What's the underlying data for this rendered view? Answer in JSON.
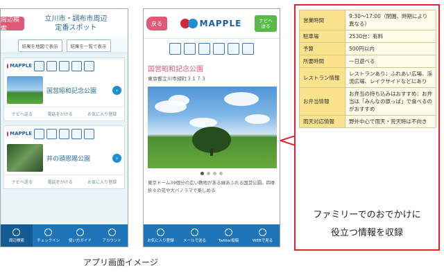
{
  "phone1": {
    "search_btn": "周辺検索",
    "title_line1": "立川市・調布市周辺",
    "title_line2": "定番スポット",
    "btn_map": "結果を地図で表示",
    "btn_list": "結果を一覧で表示",
    "cards": [
      {
        "name": "国営昭和記念公園",
        "actions": [
          "ナビへ送る",
          "電話をかける",
          "お気に入り登録"
        ]
      },
      {
        "name": "井の頭恩賜公園",
        "actions": [
          "ナビへ送る",
          "電話をかける",
          "お気に入り登録"
        ]
      }
    ],
    "tabs": [
      "周辺検索",
      "チェックイン",
      "使い方ガイド",
      "アカウント"
    ]
  },
  "phone2": {
    "back": "戻る",
    "logo": "MAPPLE",
    "navi_line1": "ナビへ",
    "navi_line2": "送る",
    "spot_name": "国営昭和記念公園",
    "address": "東京都立川市緑町３１７３",
    "desc": "東京ドーム39個分の広い敷地がある緑あふれる国営公園。四季折々の花や大バノラマで楽しめる",
    "tabs": [
      "お気に入り登録",
      "メールで送る",
      "Twitter投稿",
      "WEBで見る"
    ]
  },
  "info_table": [
    {
      "k": "営業時間",
      "v": "9:30～17:00（閉園、時期により異なる）"
    },
    {
      "k": "駐車場",
      "v": "2530台：有料"
    },
    {
      "k": "予算",
      "v": "500円以内"
    },
    {
      "k": "所要時間",
      "v": "一日遊べる"
    },
    {
      "k": "レストラン情報",
      "v": "レストランあり：ふれあい広場、渓流広場、レイクサイドなどにあり"
    },
    {
      "k": "お弁当情報",
      "v": "お弁当の持ち込みはおすすめ：お弁当は「みんなの原っぱ」で食べるのがおすすめ"
    },
    {
      "k": "雨天対応情報",
      "v": "野外中心で雨天・荒天時は不向き"
    }
  ],
  "caption_line1": "ファミリーでのおでかけに",
  "caption_line2": "役立つ情報を収録",
  "bottom_caption": "アプリ画面イメージ",
  "colors": {
    "accent_pink": "#e05a78",
    "tab_blue": "#1d74b8",
    "frame_red": "#e8202a",
    "table_key": "#fbe38e"
  }
}
